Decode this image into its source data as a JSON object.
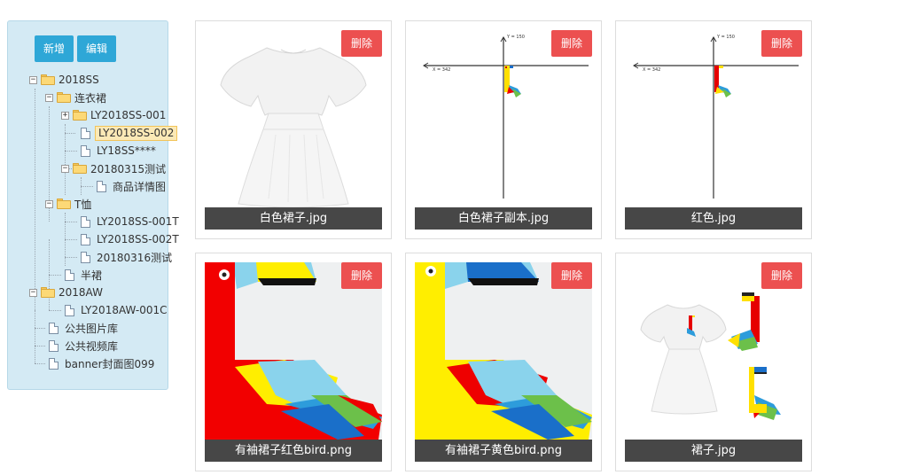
{
  "toolbar": {
    "add_label": "新增",
    "edit_label": "编辑"
  },
  "tree": {
    "root1": "2018SS",
    "dress": "连衣裙",
    "ly001": "LY2018SS-001",
    "ly002": "LY2018SS-002",
    "ly18": "LY18SS****",
    "test0315": "20180315测试",
    "detail": "商品详情图",
    "tshirt": "T恤",
    "ly001t": "LY2018SS-001T",
    "ly002t": "LY2018SS-002T",
    "test0316": "20180316测试",
    "skirt": "半裙",
    "root2": "2018AW",
    "aw001c": "LY2018AW-001C",
    "pub_img": "公共图片库",
    "pub_video": "公共视频库",
    "banner": "banner封面图099",
    "selected": "LY2018SS-002"
  },
  "cards": [
    {
      "caption": "白色裙子.jpg",
      "delete_label": "删除",
      "image": "white-dress"
    },
    {
      "caption": "白色裙子副本.jpg",
      "delete_label": "删除",
      "image": "axes-yellow-bird"
    },
    {
      "caption": "红色.jpg",
      "delete_label": "删除",
      "image": "axes-red-bird"
    },
    {
      "caption": "有袖裙子红色bird.png",
      "delete_label": "删除",
      "image": "red-bird"
    },
    {
      "caption": "有袖裙子黄色bird.png",
      "delete_label": "删除",
      "image": "yellow-bird"
    },
    {
      "caption": "裙子.jpg",
      "delete_label": "删除",
      "image": "dress-with-birds"
    }
  ],
  "axis_labels": {
    "y": "Y = 150",
    "x": "X = 342"
  },
  "colors": {
    "primary_button": "#2ea7d7",
    "delete_button": "#ec5050",
    "caption_bg": "#474747",
    "sidebar_bg": "#d4eaf4"
  }
}
